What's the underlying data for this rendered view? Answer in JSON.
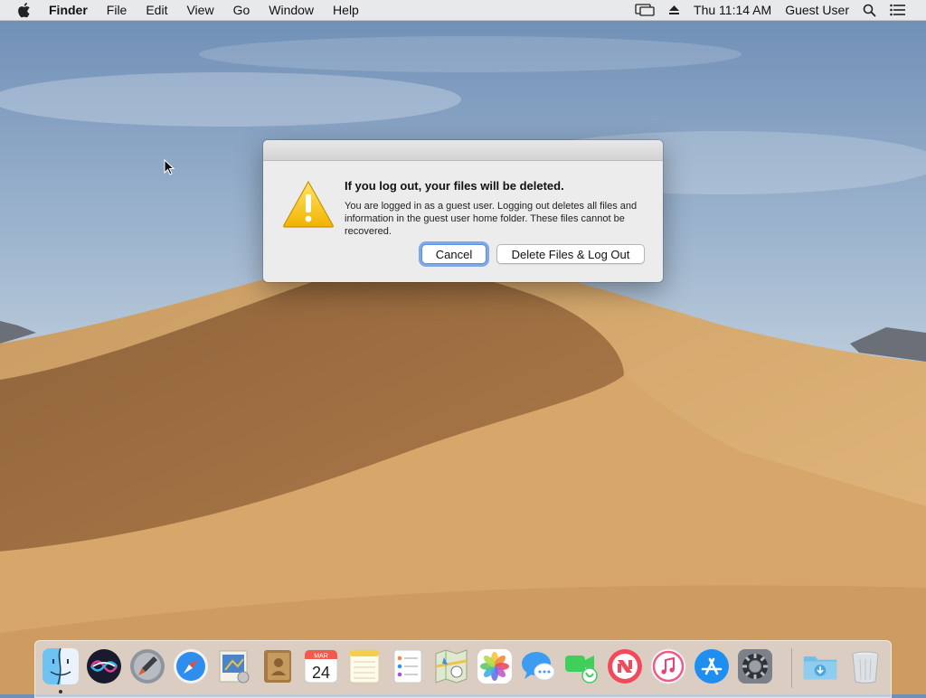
{
  "menubar": {
    "app_name": "Finder",
    "menus": [
      "File",
      "Edit",
      "View",
      "Go",
      "Window",
      "Help"
    ],
    "clock": "Thu 11:14 AM",
    "user": "Guest User",
    "status_icons": [
      "airplay-icon",
      "eject-icon",
      "spotlight-search-icon",
      "notification-center-icon"
    ]
  },
  "alert": {
    "title": "If you log out, your files will be deleted.",
    "message": "You are logged in as a guest user. Logging out deletes all files and information in the guest user home folder. These files cannot be recovered.",
    "cancel_label": "Cancel",
    "confirm_label": "Delete Files & Log Out",
    "icon": "warning-icon"
  },
  "dock": {
    "calendar_month": "MAR",
    "calendar_day": "24",
    "apps": [
      "Finder",
      "Siri",
      "Launchpad",
      "Safari",
      "Mail",
      "Contacts",
      "Calendar",
      "Notes",
      "Reminders",
      "Maps",
      "Photos",
      "Messages",
      "FaceTime",
      "News",
      "iTunes",
      "App Store",
      "System Preferences",
      "Downloads",
      "Trash"
    ]
  },
  "colors": {
    "accent": "#3b7de8",
    "warning": "#f2c21b"
  }
}
